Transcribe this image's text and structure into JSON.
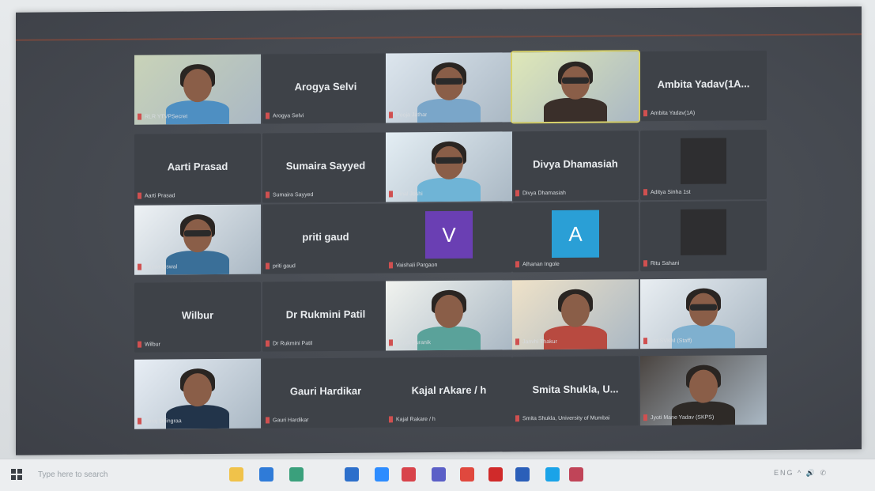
{
  "meeting": {
    "participants": [
      {
        "display_name": "",
        "tag": "RLR YTVPSecret",
        "type": "video",
        "bg": "#c9d3b8",
        "shirt": "#4e8fc2",
        "glasses": false
      },
      {
        "display_name": "Arogya Selvi",
        "tag": "Arogya Selvi",
        "type": "name"
      },
      {
        "display_name": "",
        "tag": "Pooja Jathar",
        "type": "video",
        "bg": "#dde6ee",
        "shirt": "#7aa6c9",
        "glasses": true
      },
      {
        "display_name": "",
        "tag": "",
        "type": "video",
        "bg": "#dfe8b8",
        "shirt": "#3a2f2a",
        "glasses": true,
        "highlight": true
      },
      {
        "display_name": "Ambita Yadav(1A...",
        "tag": "Ambita Yadav(1A)",
        "type": "name"
      },
      {
        "display_name": "Aarti Prasad",
        "tag": "Aarti Prasad",
        "type": "name"
      },
      {
        "display_name": "Sumaira Sayyed",
        "tag": "Sumaira Sayyed",
        "type": "name"
      },
      {
        "display_name": "",
        "tag": "Vinal Joshi",
        "type": "video",
        "bg": "#e4eef4",
        "shirt": "#6fb4d6",
        "glasses": true
      },
      {
        "display_name": "Divya Dhamasiah",
        "tag": "Divya Dhamasiah",
        "type": "name"
      },
      {
        "display_name": "",
        "tag": "Aditya Sinha 1st",
        "type": "dark"
      },
      {
        "display_name": "",
        "tag": "Sujata Oswal",
        "type": "video",
        "bg": "#eef2f5",
        "shirt": "#3a6f98",
        "glasses": true
      },
      {
        "display_name": "priti gaud",
        "tag": "priti gaud",
        "type": "name"
      },
      {
        "display_name": "",
        "tag": "Vaishali Pargaon",
        "type": "letter",
        "letter": "V",
        "color": "#6a3fb3"
      },
      {
        "display_name": "",
        "tag": "Alhanan Ingole",
        "type": "letter",
        "letter": "A",
        "color": "#2a9fd6"
      },
      {
        "display_name": "",
        "tag": "Ritu Sahani",
        "type": "dark"
      },
      {
        "display_name": "Wilbur",
        "tag": "Wilbur",
        "type": "name"
      },
      {
        "display_name": "Dr Rukmini Patil",
        "tag": "Dr Rukmini Patil",
        "type": "name"
      },
      {
        "display_name": "",
        "tag": "Shruti Puranik",
        "type": "video",
        "bg": "#f1f3ef",
        "shirt": "#5aa29a",
        "glasses": false
      },
      {
        "display_name": "",
        "tag": "Janvhi Thakur",
        "type": "video",
        "bg": "#efe2c8",
        "shirt": "#b84a40",
        "glasses": false
      },
      {
        "display_name": "",
        "tag": "Ltd SVKM (Staff)",
        "type": "video",
        "bg": "#e9eef2",
        "shirt": "#7fb0cf",
        "glasses": true
      },
      {
        "display_name": "",
        "tag": "Shraj Dhingraa",
        "type": "video",
        "bg": "#e8eef5",
        "shirt": "#22344a",
        "glasses": false
      },
      {
        "display_name": "Gauri Hardikar",
        "tag": "Gauri Hardikar",
        "type": "name"
      },
      {
        "display_name": "Kajal rAkare / h",
        "tag": "Kajal Rakare / h",
        "type": "name"
      },
      {
        "display_name": "Smita Shukla, U...",
        "tag": "Smita Shukla, University of Mumbai",
        "type": "name"
      },
      {
        "display_name": "",
        "tag": "Jyoti Mane Yadav (SKPS)",
        "type": "video",
        "bg": "#4a4440",
        "shirt": "#2e2a27",
        "glasses": false
      }
    ]
  },
  "taskbar": {
    "search_placeholder": "Type here to search",
    "icons": [
      {
        "name": "file-explorer-icon",
        "color": "#f0c24a"
      },
      {
        "name": "edge-icon",
        "color": "#2f7bd8"
      },
      {
        "name": "store-icon",
        "color": "#3aa07c"
      },
      {
        "name": "mail-icon",
        "color": "#2d6fcb"
      },
      {
        "name": "zoom-icon",
        "color": "#2d8cff"
      },
      {
        "name": "photos-icon",
        "color": "#d8434b"
      },
      {
        "name": "teams-icon",
        "color": "#5b5fc7"
      },
      {
        "name": "chrome-icon",
        "color": "#e0483e"
      },
      {
        "name": "opera-icon",
        "color": "#d02a2a"
      },
      {
        "name": "word-icon",
        "color": "#2b5fb9"
      },
      {
        "name": "skype-icon",
        "color": "#1aa3e8"
      },
      {
        "name": "app-icon",
        "color": "#c04458"
      }
    ],
    "tray_text": "ENG ^ 🔊 ✆"
  }
}
